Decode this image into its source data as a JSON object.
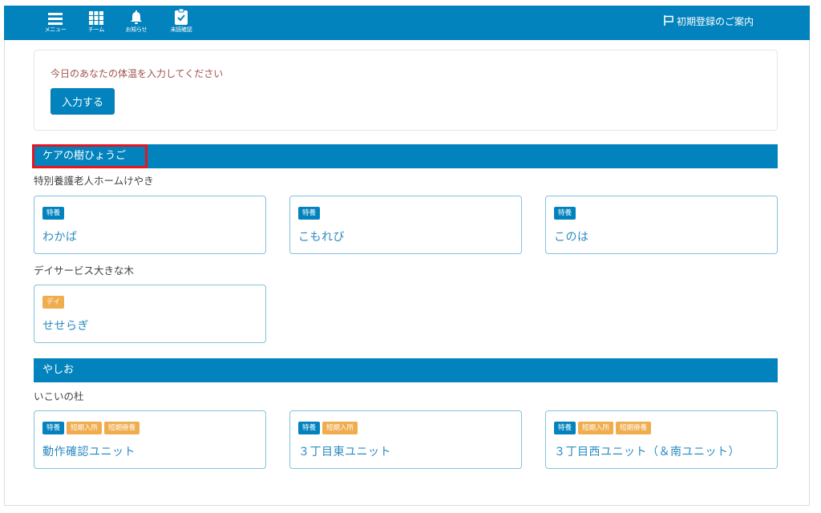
{
  "header": {
    "nav_items": [
      {
        "label": "メニュー",
        "icon": "menu-icon"
      },
      {
        "label": "チーム",
        "icon": "grid-icon"
      },
      {
        "label": "お知らせ",
        "icon": "bell-icon"
      },
      {
        "label": "未読確認",
        "icon": "clipboard-check-icon"
      }
    ],
    "guide_link": {
      "label": "初期登録のご案内",
      "icon": "flag-icon"
    }
  },
  "colors": {
    "primary": "#0383bd",
    "tag_orange": "#f0ad4e",
    "highlight": "#e8141d",
    "message": "#a0524d"
  },
  "temperature": {
    "message": "今日のあなたの体温を入力してください",
    "button_label": "入力する"
  },
  "sections": [
    {
      "title": "ケアの樹ひょうご",
      "highlighted": true,
      "facilities": [
        {
          "name": "特別養護老人ホームけやき",
          "units": [
            {
              "tags": [
                {
                  "label": "特養",
                  "color": "blue"
                }
              ],
              "name": "わかば"
            },
            {
              "tags": [
                {
                  "label": "特養",
                  "color": "blue"
                }
              ],
              "name": "こもれび"
            },
            {
              "tags": [
                {
                  "label": "特養",
                  "color": "blue"
                }
              ],
              "name": "このは"
            }
          ]
        },
        {
          "name": "デイサービス大きな木",
          "units": [
            {
              "tags": [
                {
                  "label": "デイ",
                  "color": "orange"
                }
              ],
              "name": "せせらぎ"
            }
          ]
        }
      ]
    },
    {
      "title": "やしお",
      "highlighted": false,
      "facilities": [
        {
          "name": "いこいの杜",
          "units": [
            {
              "tags": [
                {
                  "label": "特養",
                  "color": "blue"
                },
                {
                  "label": "短期入所",
                  "color": "orange"
                },
                {
                  "label": "短期療養",
                  "color": "orange"
                }
              ],
              "name": "動作確認ユニット"
            },
            {
              "tags": [
                {
                  "label": "特養",
                  "color": "blue"
                },
                {
                  "label": "短期入所",
                  "color": "orange"
                }
              ],
              "name": "３丁目東ユニット"
            },
            {
              "tags": [
                {
                  "label": "特養",
                  "color": "blue"
                },
                {
                  "label": "短期入所",
                  "color": "orange"
                },
                {
                  "label": "短期療養",
                  "color": "orange"
                }
              ],
              "name": "３丁目西ユニット（＆南ユニット）"
            }
          ]
        }
      ]
    }
  ]
}
